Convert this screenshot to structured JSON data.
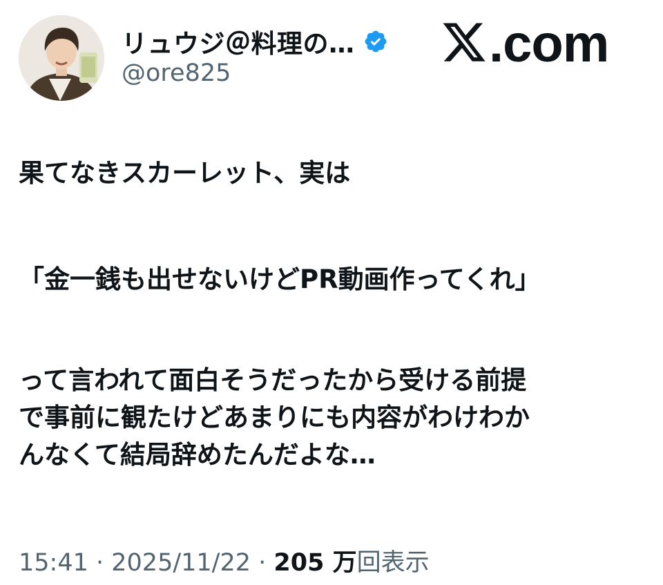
{
  "author": {
    "display_name": "リュウジ＠料理の…",
    "handle": "@ore825",
    "verified": true,
    "avatar_icon": "profile-photo",
    "verified_icon": "verified-badge-icon",
    "verified_color": "#1d9bf0"
  },
  "brand": {
    "logo_icon": "x-logo-icon",
    "text": ".com"
  },
  "post": {
    "lines": [
      "果てなきスカーレット、実は",
      "「金一銭も出せないけどPR動画作ってくれ」",
      "って言われて面白そうだったから受ける前提",
      "で事前に観たけどあまりにも内容がわけわか",
      "んなくて結局辞めたんだよな…"
    ]
  },
  "meta": {
    "time": "15:41",
    "separator": " · ",
    "date": "2025/11/22",
    "views_count": "205 万",
    "views_label": "回表示"
  },
  "colors": {
    "text_primary": "#0f1419",
    "text_secondary": "#536471",
    "background": "#ffffff"
  }
}
